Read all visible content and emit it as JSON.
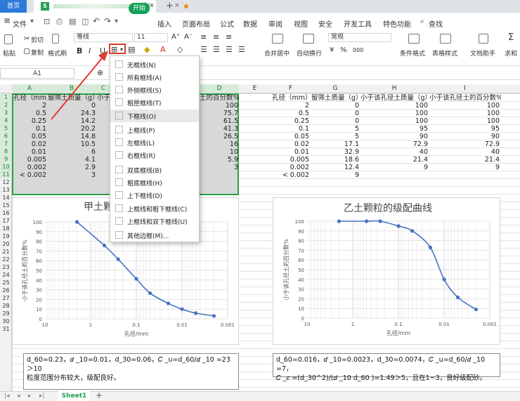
{
  "titlebar": {
    "home_tab": "首页",
    "file_name": ".xlsx",
    "close": "×",
    "add": "+"
  },
  "menubar": {
    "hamburger": "≡",
    "file_menu": "文件",
    "items": [
      "开始",
      "插入",
      "页面布局",
      "公式",
      "数据",
      "审阅",
      "视图",
      "安全",
      "开发工具",
      "特色功能"
    ],
    "search": "查找"
  },
  "ribbon": {
    "paste": "粘贴",
    "cut": "剪切",
    "copy": "复制",
    "format_painter": "格式刷",
    "font_name": "等线",
    "font_size": "11",
    "bold": "B",
    "italic": "I",
    "underline": "U",
    "merge_center": "合并居中",
    "wrap": "自动换行",
    "number_format": "常规",
    "percent": "%",
    "thousands": "000",
    "cond_format": "条件格式",
    "table_style": "表格样式",
    "doc_helper": "文档助手",
    "sum": "求和"
  },
  "formula_bar": {
    "name_box": "A1"
  },
  "columns": [
    "A",
    "B",
    "C",
    "D",
    "E",
    "F",
    "G",
    "H",
    "I"
  ],
  "rows": [
    "1",
    "2",
    "3",
    "4",
    "5",
    "6",
    "7",
    "8",
    "9",
    "10",
    "11",
    "12",
    "13",
    "14",
    "15",
    "16",
    "17",
    "18",
    "19",
    "20",
    "21",
    "22",
    "23",
    "24",
    "25",
    "26",
    "27",
    "28",
    "29",
    "30",
    "31"
  ],
  "sheet_left": {
    "headers": [
      "孔径（mm）",
      "留筛土质量（g）",
      "小于",
      "土的百分数%"
    ],
    "rows": [
      [
        "2",
        "0",
        "100"
      ],
      [
        "0.5",
        "24.3",
        "75.7"
      ],
      [
        "0.25",
        "14.2",
        "61.5"
      ],
      [
        "0.1",
        "20.2",
        "41.3"
      ],
      [
        "0.05",
        "14.8",
        "26.5"
      ],
      [
        "0.02",
        "10.5",
        "16"
      ],
      [
        "0.01",
        "6",
        "10"
      ],
      [
        "0.005",
        "4.1",
        "5.9"
      ],
      [
        "0.002",
        "2.9",
        "3"
      ],
      [
        "< 0.002",
        "3",
        ""
      ]
    ]
  },
  "sheet_right": {
    "headers": [
      "孔径（mm）",
      "留筛土质量（g）",
      "小于该孔径土质量（g）",
      "小于该孔径土的百分数%"
    ],
    "rows": [
      [
        "2",
        "0",
        "100",
        "100"
      ],
      [
        "0.5",
        "0",
        "100",
        "100"
      ],
      [
        "0.25",
        "0",
        "100",
        "100"
      ],
      [
        "0.1",
        "5",
        "95",
        "95"
      ],
      [
        "0.05",
        "5",
        "90",
        "90"
      ],
      [
        "0.02",
        "17.1",
        "72.9",
        "72.9"
      ],
      [
        "0.01",
        "32.9",
        "40",
        "40"
      ],
      [
        "0.005",
        "18.6",
        "21.4",
        "21.4"
      ],
      [
        "0.002",
        "12.4",
        "9",
        "9"
      ],
      [
        "< 0.002",
        "9",
        "",
        ""
      ]
    ]
  },
  "border_menu": {
    "items": [
      "无框线(N)",
      "所有框线(A)",
      "外侧框线(S)",
      "粗匣框线(T)",
      "下框线(O)",
      "上框线(P)",
      "左框线(L)",
      "右框线(R)",
      "双底框线(B)",
      "粗底框线(H)",
      "上下框线(D)",
      "上框线和粗下框线(C)",
      "上框线和双下框线(U)",
      "其他边框(M)..."
    ],
    "highlighted_index": 4
  },
  "chart_data": [
    {
      "type": "line",
      "title": "甲土颗",
      "xlabel": "孔径/mm",
      "ylabel": "小于该孔径土的百分数%",
      "x_scale": "log-reversed",
      "xlim": [
        10,
        0.001
      ],
      "ylim": [
        0,
        100
      ],
      "x_ticks": [
        "10",
        "1",
        "0.1",
        "0.01",
        "0.001"
      ],
      "y_ticks": [
        "0",
        "10",
        "20",
        "30",
        "40",
        "50",
        "60",
        "70",
        "80",
        "90",
        "100"
      ],
      "x": [
        0.5,
        0.25,
        0.1,
        0.05,
        0.02,
        0.01,
        0.005,
        0.002
      ],
      "y": [
        100,
        75.7,
        61.5,
        41.3,
        26.5,
        16,
        10,
        5.9,
        3
      ],
      "points_x": [
        2,
        0.5,
        0.25,
        0.1,
        0.05,
        0.02,
        0.01,
        0.005,
        0.002
      ],
      "color": "#4472c4",
      "grid": true
    },
    {
      "type": "line",
      "title": "乙土颗粒的级配曲线",
      "xlabel": "孔径/mm",
      "ylabel": "小于该孔径土的百分数%",
      "x_scale": "log-reversed",
      "xlim": [
        10,
        0.001
      ],
      "ylim": [
        0,
        100
      ],
      "x_ticks": [
        "10",
        "1",
        "0.1",
        "0.01",
        "0.001"
      ],
      "y_ticks": [
        "0",
        "10",
        "20",
        "30",
        "40",
        "50",
        "60",
        "70",
        "80",
        "90",
        "100"
      ],
      "points_x": [
        2,
        0.5,
        0.25,
        0.1,
        0.05,
        0.02,
        0.01,
        0.005,
        0.002
      ],
      "y": [
        100,
        100,
        100,
        95,
        90,
        72.9,
        40,
        21.4,
        9
      ],
      "color": "#4472c4",
      "grid": true
    }
  ],
  "notes": {
    "left_line1": "d_60=0.23，𝑑 _10=0.01，d_30=0.06，𝐶 _u=d_60/𝑑 _10 =23",
    "left_line2": "＞10",
    "left_line3": "粒度范围分布较大，级配良好。",
    "right_line1": "d_60=0.016，𝑑 _10=0.0023，d_30=0.0074，𝐶 _u=d_60/𝑑 _10 =7，",
    "right_line2": "𝐶 _𝑐 =(d_30^2)/(𝑑 _10 d_60 )=1.49＞5，且在1~3，良好级配砂。"
  },
  "sheet_tabs": {
    "active": "Sheet1",
    "add": "+"
  }
}
